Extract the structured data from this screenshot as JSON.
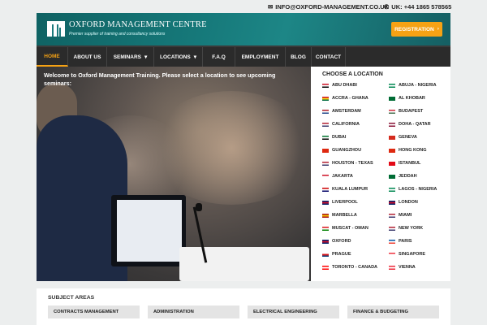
{
  "topbar": {
    "email": "INFO@OXFORD-MANAGEMENT.CO.UK",
    "phone": "UK: +44 1865 578565",
    "email_icon": "envelope-icon",
    "phone_icon": "phone-icon"
  },
  "header": {
    "title": "OXFORD MANAGEMENT CENTRE",
    "subtitle": "Premier supplier of training and consultancy solutions",
    "register_label": "REGISTRATION"
  },
  "nav": {
    "items": [
      {
        "label": "HOME",
        "active": true
      },
      {
        "label": "ABOUT US"
      },
      {
        "label": "SEMINARS",
        "dropdown": true
      },
      {
        "label": "LOCATIONS",
        "dropdown": true
      },
      {
        "label": "F.A.Q"
      },
      {
        "label": "EMPLOYMENT"
      },
      {
        "label": "BLOG"
      },
      {
        "label": "CONTACT"
      }
    ]
  },
  "hero": {
    "text": "Welcome to Oxford Management Training. Please select a location to see upcoming seminars:"
  },
  "locations": {
    "title": "CHOOSE A LOCATION",
    "items": [
      {
        "label": "ABU DHABI",
        "flag": [
          "#ce1126",
          "#fff",
          "#000"
        ]
      },
      {
        "label": "ABUJA - NIGERIA",
        "flag": [
          "#008751",
          "#fff",
          "#008751"
        ]
      },
      {
        "label": "ACCRA - GHANA",
        "flag": [
          "#ce1126",
          "#fcd116",
          "#006b3f"
        ]
      },
      {
        "label": "AL KHOBAR",
        "flag": [
          "#006c35",
          "#006c35",
          "#006c35"
        ]
      },
      {
        "label": "AMSTERDAM",
        "flag": [
          "#ae1c28",
          "#fff",
          "#21468b"
        ]
      },
      {
        "label": "BUDAPEST",
        "flag": [
          "#ce2939",
          "#fff",
          "#477050"
        ]
      },
      {
        "label": "CALIFORNIA",
        "flag": [
          "#b22234",
          "#fff",
          "#3c3b6e"
        ]
      },
      {
        "label": "DOHA - QATAR",
        "flag": [
          "#8a1538",
          "#fff",
          "#8a1538"
        ]
      },
      {
        "label": "DUBAI",
        "flag": [
          "#00732f",
          "#fff",
          "#000"
        ]
      },
      {
        "label": "GENEVA",
        "flag": [
          "#d52b1e",
          "#d52b1e",
          "#d52b1e"
        ]
      },
      {
        "label": "GUANGZHOU",
        "flag": [
          "#de2910",
          "#de2910",
          "#de2910"
        ]
      },
      {
        "label": "HONG KONG",
        "flag": [
          "#de2910",
          "#de2910",
          "#de2910"
        ]
      },
      {
        "label": "HOUSTON - TEXAS",
        "flag": [
          "#b22234",
          "#fff",
          "#3c3b6e"
        ]
      },
      {
        "label": "ISTANBUL",
        "flag": [
          "#e30a17",
          "#e30a17",
          "#e30a17"
        ]
      },
      {
        "label": "JAKARTA",
        "flag": [
          "#ce1126",
          "#fff",
          "#fff"
        ]
      },
      {
        "label": "JEDDAH",
        "flag": [
          "#006c35",
          "#006c35",
          "#006c35"
        ]
      },
      {
        "label": "KUALA LUMPUR",
        "flag": [
          "#cc0001",
          "#fff",
          "#010066"
        ]
      },
      {
        "label": "LAGOS - NIGERIA",
        "flag": [
          "#008751",
          "#fff",
          "#008751"
        ]
      },
      {
        "label": "LIVERPOOL",
        "flag": [
          "#012169",
          "#c8102e",
          "#012169"
        ]
      },
      {
        "label": "LONDON",
        "flag": [
          "#012169",
          "#c8102e",
          "#012169"
        ]
      },
      {
        "label": "MARBELLA",
        "flag": [
          "#aa151b",
          "#f1bf00",
          "#aa151b"
        ]
      },
      {
        "label": "MIAMI",
        "flag": [
          "#b22234",
          "#fff",
          "#3c3b6e"
        ]
      },
      {
        "label": "MUSCAT - OMAN",
        "flag": [
          "#db161b",
          "#fff",
          "#008000"
        ]
      },
      {
        "label": "NEW YORK",
        "flag": [
          "#b22234",
          "#fff",
          "#3c3b6e"
        ]
      },
      {
        "label": "OXFORD",
        "flag": [
          "#012169",
          "#c8102e",
          "#012169"
        ]
      },
      {
        "label": "PARIS",
        "flag": [
          "#0055a4",
          "#fff",
          "#ef4135"
        ]
      },
      {
        "label": "PRAGUE",
        "flag": [
          "#fff",
          "#d7141a",
          "#11457e"
        ]
      },
      {
        "label": "SINGAPORE",
        "flag": [
          "#ef3340",
          "#fff",
          "#fff"
        ]
      },
      {
        "label": "TORONTO - CANADA",
        "flag": [
          "#ff0000",
          "#fff",
          "#ff0000"
        ]
      },
      {
        "label": "VIENNA",
        "flag": [
          "#ed2939",
          "#fff",
          "#ed2939"
        ]
      }
    ]
  },
  "subjects": {
    "title": "SUBJECT AREAS",
    "items": [
      "CONTRACTS MANAGEMENT",
      "ADMINISTRATION",
      "ELECTRICAL ENGINEERING",
      "FINANCE & BUDGETING"
    ]
  },
  "colors": {
    "teal": "#1c7a7c",
    "accent": "#f6a214",
    "nav_bg": "#2b2b2b"
  }
}
